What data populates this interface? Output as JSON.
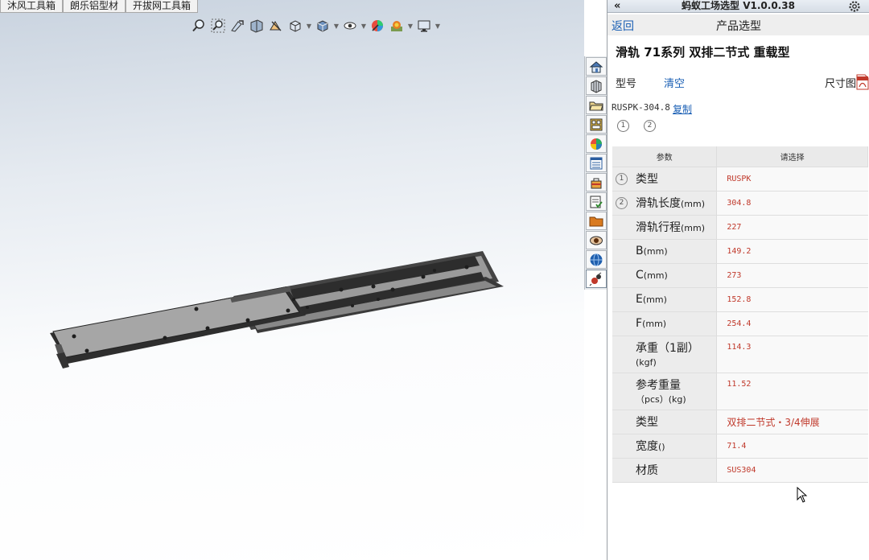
{
  "viewport": {
    "doc_tabs": [
      "沐风工具箱",
      "朗乐铝型材",
      "开拔网工具箱"
    ],
    "heads_up_icons": [
      "zoom-to-fit-icon",
      "zoom-area-icon",
      "previous-view-icon",
      "section-view-icon",
      "dynamic-annotation-icon",
      "view-orientation-icon",
      "display-style-icon",
      "hide-show-items-icon",
      "edit-appearance-icon",
      "apply-scene-icon",
      "view-settings-icon"
    ]
  },
  "task_pane_tabs": [
    "home-icon",
    "parts-library-icon",
    "file-explorer-icon",
    "view-palette-icon",
    "appearances-icon",
    "custom-properties-icon",
    "toolbox-icon",
    "design-checker-icon",
    "folder-icon",
    "eye-icon",
    "globe-icon",
    "ant-selector-icon"
  ],
  "panel": {
    "title": "蚂蚁工场选型 V1.0.0.38",
    "collapse": "«",
    "back": "返回",
    "head_title": "产品选型",
    "product_title": "滑轨 71系列 双排二节式 重载型",
    "model_label": "型号",
    "clear": "清空",
    "dimension_label": "尺寸图",
    "code": "RUSPK-304.8",
    "copy": "复制",
    "steps": [
      "1",
      "2"
    ],
    "table": {
      "headers": [
        "参数",
        "请选择"
      ],
      "rows": [
        {
          "num": "1",
          "name": "类型",
          "unit": "",
          "value": "RUSPK"
        },
        {
          "num": "2",
          "name": "滑轨长度",
          "unit": "(mm)",
          "value": "304.8"
        },
        {
          "num": "",
          "name": "滑轨行程",
          "unit": "(mm)",
          "value": "227"
        },
        {
          "num": "",
          "name": "B",
          "unit": "(mm)",
          "value": "149.2"
        },
        {
          "num": "",
          "name": "C",
          "unit": "(mm)",
          "value": "273"
        },
        {
          "num": "",
          "name": "E",
          "unit": "(mm)",
          "value": "152.8"
        },
        {
          "num": "",
          "name": "F",
          "unit": "(mm)",
          "value": "254.4"
        },
        {
          "num": "",
          "name": "承重（1副）",
          "unit": "(kgf)",
          "value": "114.3"
        },
        {
          "num": "",
          "name": "参考重量",
          "unit": "（pcs）(kg)",
          "value": "11.52"
        },
        {
          "num": "",
          "name": "类型",
          "unit": "",
          "value": "双排二节式・3/4伸展"
        },
        {
          "num": "",
          "name": "宽度",
          "unit": "()",
          "value": "71.4"
        },
        {
          "num": "",
          "name": "材质",
          "unit": "",
          "value": "SUS304"
        }
      ]
    }
  }
}
